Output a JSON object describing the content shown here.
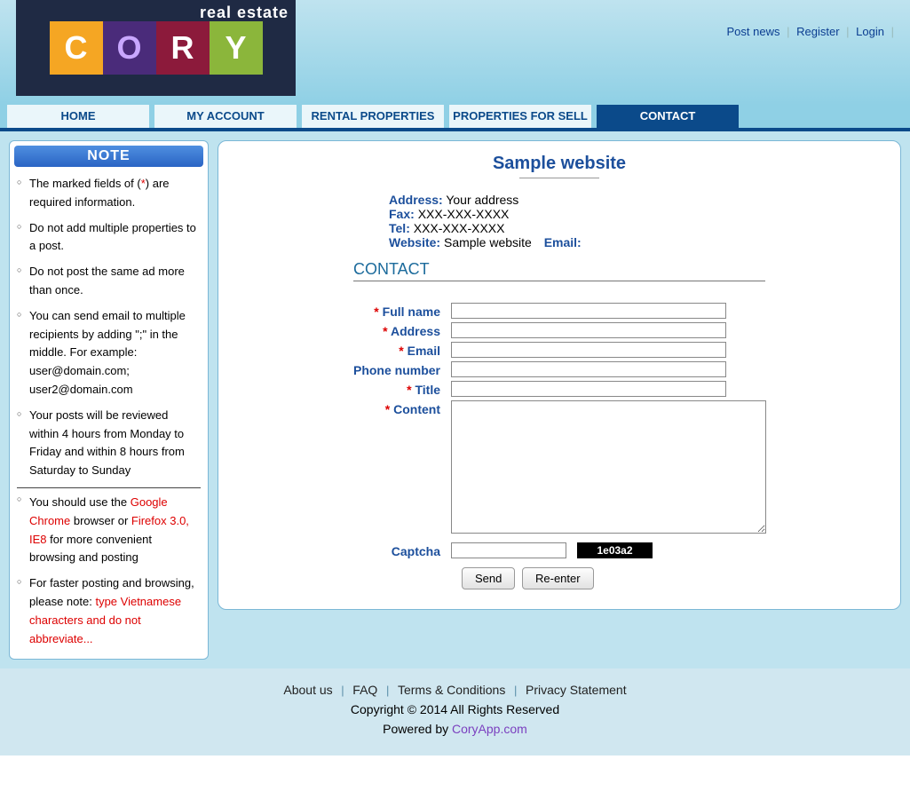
{
  "top_links": {
    "post_news": "Post news",
    "register": "Register",
    "login": "Login"
  },
  "logo": {
    "tag": "real estate",
    "letters": [
      "C",
      "O",
      "R",
      "Y"
    ]
  },
  "nav": {
    "items": [
      {
        "label": "HOME"
      },
      {
        "label": "MY ACCOUNT"
      },
      {
        "label": "RENTAL PROPERTIES"
      },
      {
        "label": "PROPERTIES FOR SELL"
      },
      {
        "label": "CONTACT",
        "active": true
      }
    ]
  },
  "sidebar": {
    "title": "NOTE",
    "items": [
      {
        "pre": "The marked fields of (",
        "red": "*",
        "post": ") are required information."
      },
      {
        "text": "Do not add multiple properties to a post."
      },
      {
        "text": "Do not post the same ad more than once."
      },
      {
        "text": "You can send email to multiple recipients by adding \";\" in the middle. For example: user@domain.com; user2@domain.com"
      },
      {
        "text": "Your posts will be reviewed within 4 hours from Monday to Friday and within 8 hours from Saturday to Sunday"
      },
      {
        "pre": "You should use the ",
        "red": "Google Chrome",
        "mid": " browser or ",
        "red2": "Firefox 3.0, IE8",
        "post": " for more convenient browsing and posting",
        "sep": true
      },
      {
        "pre": "For faster posting and browsing, please note: ",
        "red": "type Vietnamese characters and do not abbreviate...",
        "post": ""
      }
    ]
  },
  "page": {
    "title": "Sample website",
    "info": {
      "address_l": "Address:",
      "address_v": "Your address",
      "fax_l": "Fax:",
      "fax_v": "XXX-XXX-XXXX",
      "tel_l": "Tel:",
      "tel_v": "XXX-XXX-XXXX",
      "website_l": "Website:",
      "website_v": "Sample website",
      "email_l": "Email:"
    },
    "section": "CONTACT",
    "form": {
      "fullname": "Full name",
      "address": "Address",
      "email": "Email",
      "phone": "Phone number",
      "title": "Title",
      "content": "Content",
      "captcha": "Captcha",
      "captcha_code": "1e03a2",
      "send": "Send",
      "reenter": "Re-enter"
    }
  },
  "footer": {
    "links": {
      "about": "About us",
      "faq": "FAQ",
      "terms": "Terms & Conditions",
      "privacy": "Privacy Statement"
    },
    "copyright": "Copyright © 2014 All Rights Reserved",
    "powered_pre": "Powered by ",
    "powered_link": "CoryApp.com"
  }
}
